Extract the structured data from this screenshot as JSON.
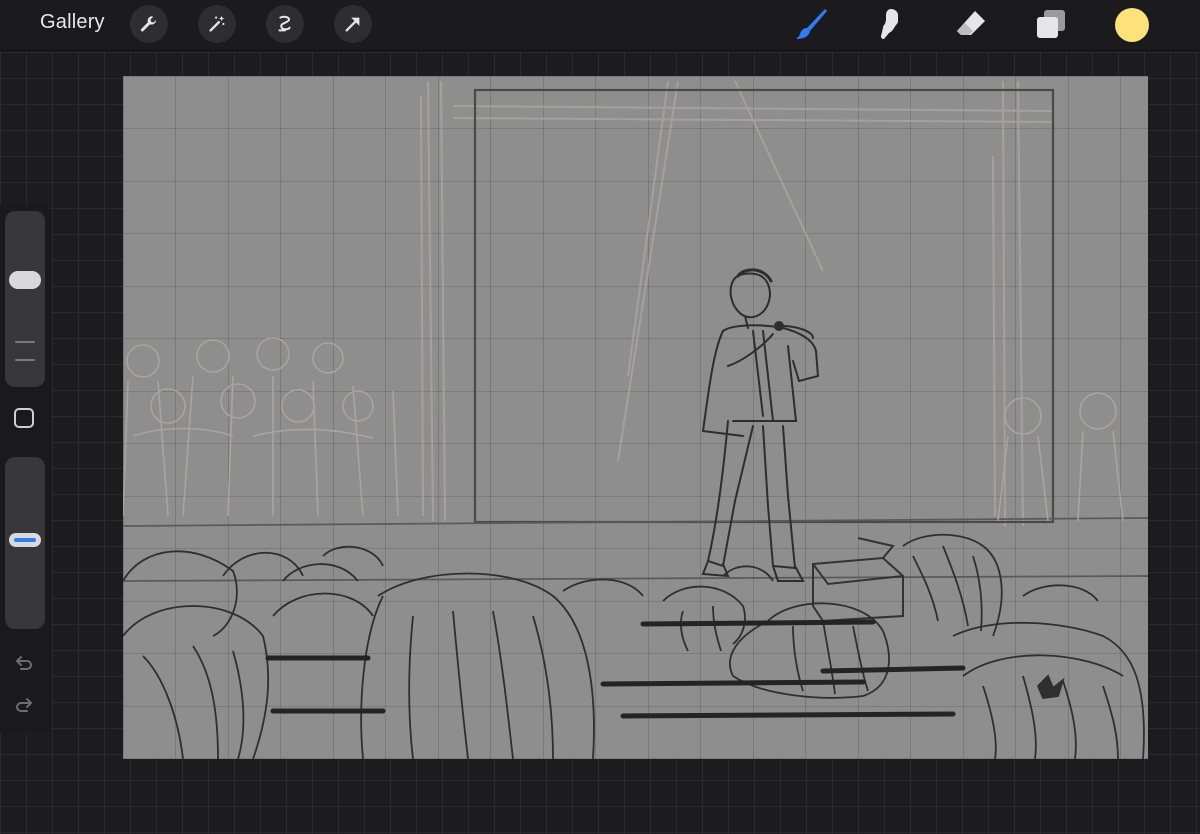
{
  "app": {
    "gallery_label": "Gallery"
  },
  "toolbar_left": [
    {
      "name": "actions-wrench-icon"
    },
    {
      "name": "adjustments-wand-icon"
    },
    {
      "name": "selection-icon"
    },
    {
      "name": "transform-arrow-icon"
    }
  ],
  "toolbar_right": [
    {
      "name": "brush-icon",
      "active": true
    },
    {
      "name": "smudge-icon"
    },
    {
      "name": "eraser-icon"
    },
    {
      "name": "layers-icon"
    }
  ],
  "colors": {
    "current_color": "#fde27a",
    "active_tool_accent": "#2f7cf6",
    "canvas_background": "#8e8e8f",
    "app_background": "#1c1c1e"
  },
  "sidebar": {
    "brush_size_level": 0.62,
    "brush_opacity_level": 0.52
  },
  "canvas": {
    "grid": true,
    "subject": "pencil-sketch-stage-performer-audience"
  }
}
